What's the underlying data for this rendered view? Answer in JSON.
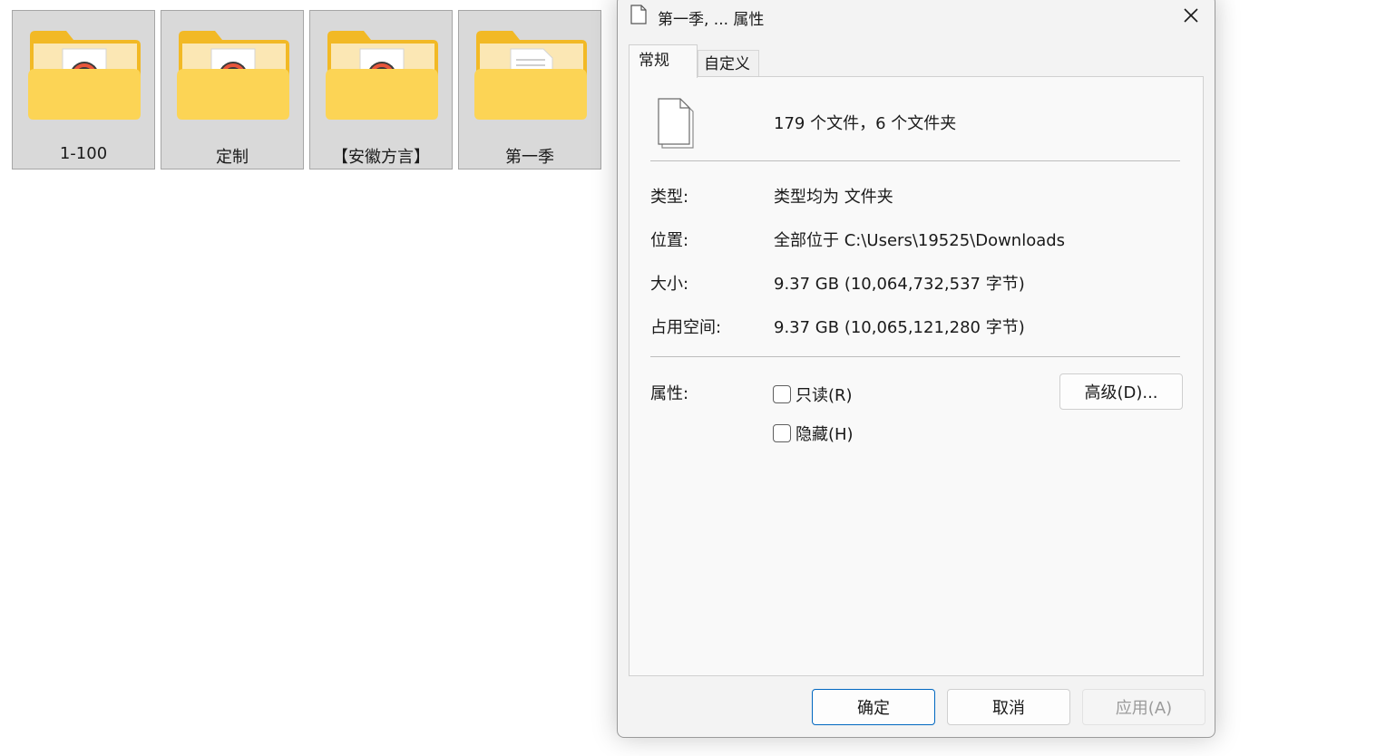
{
  "folders": [
    {
      "label": "1-100",
      "icon": "folder-with-media-file-icon"
    },
    {
      "label": "定制",
      "icon": "folder-with-media-file-icon"
    },
    {
      "label": "【安徽方言】",
      "icon": "folder-with-media-file-icon"
    },
    {
      "label": "第一季",
      "icon": "folder-with-document-icon"
    }
  ],
  "dialog": {
    "title": "第一季, ... 属性",
    "tabs": [
      {
        "label": "常规",
        "active": true
      },
      {
        "label": "自定义",
        "active": false
      }
    ],
    "summary": "179 个文件，6 个文件夹",
    "rows": [
      {
        "label": "类型:",
        "value": "类型均为 文件夹"
      },
      {
        "label": "位置:",
        "value": "全部位于 C:\\Users\\19525\\Downloads"
      },
      {
        "label": "大小:",
        "value": "9.37 GB (10,064,732,537 字节)"
      },
      {
        "label": "占用空间:",
        "value": "9.37 GB (10,065,121,280 字节)"
      }
    ],
    "attributes": {
      "label": "属性:",
      "readonly": {
        "label": "只读(R)",
        "checked": false
      },
      "hidden": {
        "label": "隐藏(H)",
        "checked": false
      },
      "advanced_label": "高级(D)..."
    },
    "buttons": {
      "ok": "确定",
      "cancel": "取消",
      "apply": "应用(A)"
    }
  },
  "colors": {
    "folder_back": "#f2b925",
    "folder_front": "#fcd455",
    "accent_border": "#0067c0"
  }
}
